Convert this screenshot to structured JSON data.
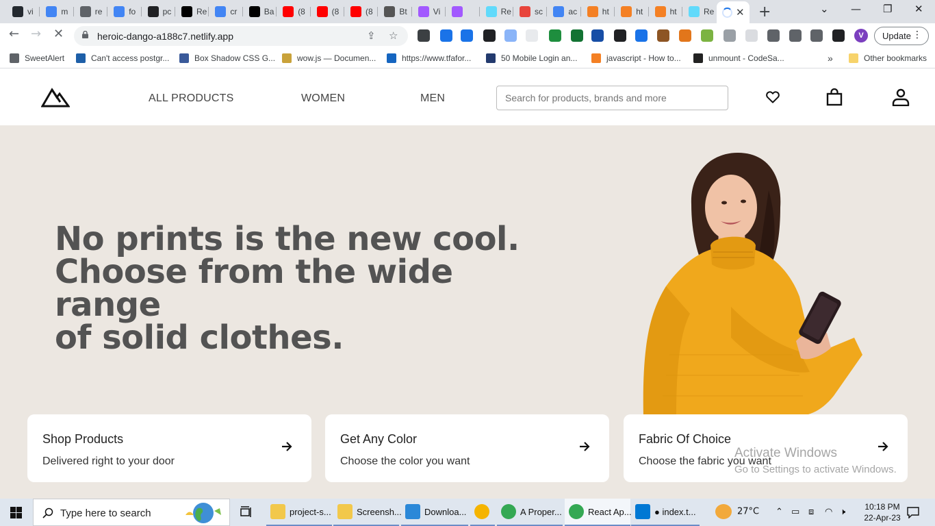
{
  "browser": {
    "tabs": [
      {
        "title": "vi",
        "icon": "github-icon",
        "color": "#24292f"
      },
      {
        "title": "m",
        "icon": "google-icon",
        "color": "#4285f4"
      },
      {
        "title": "re",
        "icon": "globe-icon",
        "color": "#5f6368"
      },
      {
        "title": "fo",
        "icon": "google-icon",
        "color": "#4285f4"
      },
      {
        "title": "pc",
        "icon": "square-icon",
        "color": "#202124"
      },
      {
        "title": "Re",
        "icon": "dev-icon",
        "color": "#000000"
      },
      {
        "title": "cr",
        "icon": "google-icon",
        "color": "#4285f4"
      },
      {
        "title": "Ba",
        "icon": "medium-icon",
        "color": "#000000"
      },
      {
        "title": "(8",
        "icon": "youtube-icon",
        "color": "#ff0000"
      },
      {
        "title": "(8",
        "icon": "youtube-icon",
        "color": "#ff0000"
      },
      {
        "title": "(8",
        "icon": "youtube-icon",
        "color": "#ff0000"
      },
      {
        "title": "Bt",
        "icon": "peace-icon",
        "color": "#555555"
      },
      {
        "title": "Vi",
        "icon": "figma-icon",
        "color": "#a259ff"
      },
      {
        "title": "",
        "icon": "figma-play-icon",
        "color": "#a259ff"
      },
      {
        "title": "Re",
        "icon": "react-icon",
        "color": "#61dafb"
      },
      {
        "title": "sc",
        "icon": "asterisk-icon",
        "color": "#e8453c"
      },
      {
        "title": "ac",
        "icon": "google-icon",
        "color": "#4285f4"
      },
      {
        "title": "ht",
        "icon": "stackoverflow-icon",
        "color": "#f48024"
      },
      {
        "title": "ht",
        "icon": "stackoverflow-icon",
        "color": "#f48024"
      },
      {
        "title": "ht",
        "icon": "stackoverflow-icon",
        "color": "#f48024"
      },
      {
        "title": "Re",
        "icon": "react-icon",
        "color": "#61dafb"
      }
    ],
    "active_tab_close": "✕",
    "new_tab": "+",
    "url": "heroic-dango-a188c7.netlify.app",
    "profile_initial": "V",
    "update_label": "Update",
    "bookmarks": [
      {
        "label": "SweetAlert",
        "color": "#5f6368"
      },
      {
        "label": "Can't access postgr...",
        "color": "#1e5fa8"
      },
      {
        "label": "Box Shadow CSS G...",
        "color": "#3a5a9a"
      },
      {
        "label": "wow.js — Documen...",
        "color": "#c9a23a"
      },
      {
        "label": "https://www.tfafor...",
        "color": "#1565c0"
      },
      {
        "label": "50 Mobile Login an...",
        "color": "#233a6e"
      },
      {
        "label": "javascript - How to...",
        "color": "#f48024"
      },
      {
        "label": "unmount - CodeSa...",
        "color": "#222222"
      }
    ],
    "bookmarks_more": "»",
    "other_bookmarks": "Other bookmarks"
  },
  "site": {
    "nav": [
      "ALL PRODUCTS",
      "WOMEN",
      "MEN"
    ],
    "search_placeholder": "Search for products, brands and more",
    "headline": [
      "No prints is the new cool.",
      "Choose from the wide range",
      "of solid clothes."
    ],
    "cards": [
      {
        "title": "Shop Products",
        "subtitle": "Delivered right to your door"
      },
      {
        "title": "Get Any Color",
        "subtitle": "Choose the color you want"
      },
      {
        "title": "Fabric Of Choice",
        "subtitle": "Choose the fabric you want"
      }
    ],
    "colors": {
      "hero_bg": "#ece7e1",
      "headline": "#535353",
      "sweater": "#f0a81c"
    }
  },
  "watermark": {
    "title": "Activate Windows",
    "subtitle": "Go to Settings to activate Windows."
  },
  "taskbar": {
    "search_placeholder": "Type here to search",
    "apps": [
      {
        "label": "project-s...",
        "icon": "folder-icon"
      },
      {
        "label": "Screensh...",
        "icon": "folder-icon"
      },
      {
        "label": "Downloa...",
        "icon": "download-icon"
      },
      {
        "label": "",
        "icon": "chrome-canary-icon"
      },
      {
        "label": "A Proper...",
        "icon": "chrome-icon"
      },
      {
        "label": "React Ap...",
        "icon": "chrome-icon"
      },
      {
        "label": "● index.t...",
        "icon": "vscode-icon"
      }
    ],
    "temperature": "27°C",
    "time": "10:18 PM",
    "date": "22-Apr-23"
  }
}
